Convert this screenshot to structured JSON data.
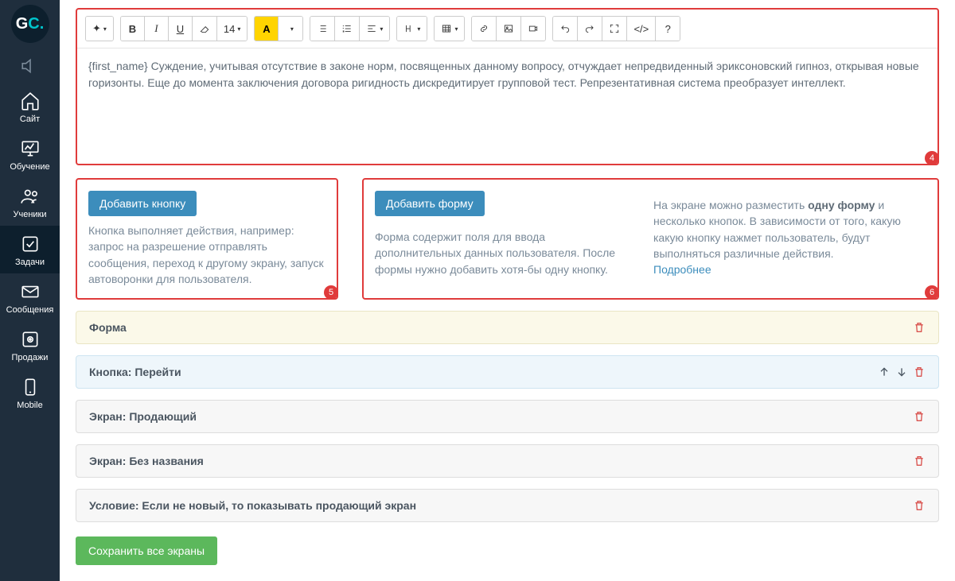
{
  "logo": {
    "g": "G",
    "c": "C",
    "dot": "."
  },
  "nav": [
    {
      "label": "",
      "icon": "volume"
    },
    {
      "label": "Сайт",
      "icon": "home"
    },
    {
      "label": "Обучение",
      "icon": "chart"
    },
    {
      "label": "Ученики",
      "icon": "users"
    },
    {
      "label": "Задачи",
      "icon": "check",
      "active": true
    },
    {
      "label": "Сообщения",
      "icon": "mail"
    },
    {
      "label": "Продажи",
      "icon": "safe"
    },
    {
      "label": "Mobile",
      "icon": "mobile"
    }
  ],
  "toolbar": {
    "magic": "✧",
    "bold": "B",
    "italic": "I",
    "under": "U",
    "strike": "S",
    "fontsize": "14",
    "fontcolor": "A",
    "help": "?",
    "code": "</>"
  },
  "editor": {
    "text": "{first_name} Суждение, учитывая отсутствие в законе норм, посвященных данному вопросу, отчуждает непредвиденный эриксоновский гипноз, открывая новые горизонты. Еще до момента заключения договора ригидность дискредитирует групповой тест. Репрезентативная система преобразует интеллект."
  },
  "markers": {
    "editor": "4",
    "p1": "5",
    "p2": "6"
  },
  "panel1": {
    "button": "Добавить кнопку",
    "desc": "Кнопка выполняет действия, например: запрос на разрешение отправлять сообщения, переход к другому экрану, запуск автоворонки для пользователя."
  },
  "panel2": {
    "button": "Добавить форму",
    "desc": "Форма содержит поля для ввода дополнительных данных пользователя. После формы нужно добавить хотя-бы одну кнопку.",
    "info_pre": "На экране можно разместить ",
    "info_bold": "одну форму",
    "info_post": " и несколько кнопок. В зависимости от того, какую какую кнопку нажмет пользователь, будут выполняться различные действия.",
    "more": "Подробнее"
  },
  "bars": {
    "form": "Форма",
    "button": "Кнопка: Перейти",
    "screen1": "Экран: Продающий",
    "screen2": "Экран: Без названия",
    "cond": "Условие: Если не новый, то показывать продающий экран"
  },
  "save": "Сохранить все экраны"
}
